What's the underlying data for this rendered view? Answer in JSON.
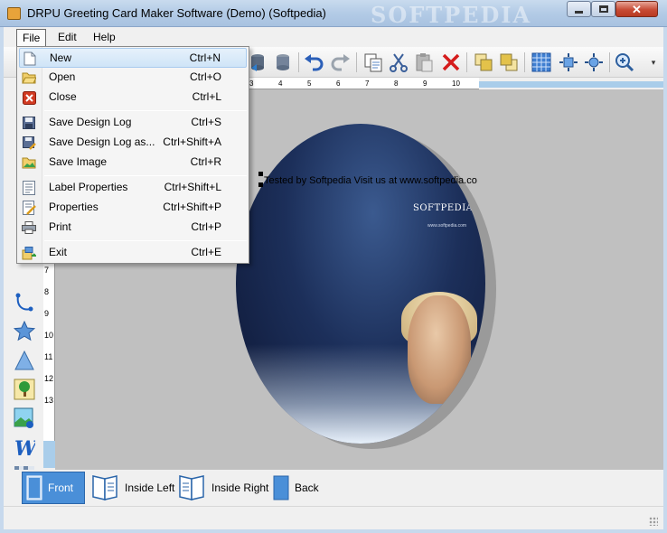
{
  "window": {
    "title": "DRPU Greeting Card Maker Software (Demo) (Softpedia)",
    "watermark": "SOFTPEDIA",
    "minimize_icon": "minimize-icon",
    "maximize_icon": "maximize-icon",
    "close_icon": "close-icon",
    "close_glyph": "✕"
  },
  "menubar": {
    "file": "File",
    "edit": "Edit",
    "help": "Help"
  },
  "file_menu": {
    "items": [
      {
        "label": "New",
        "shortcut": "Ctrl+N",
        "icon": "new-document-icon",
        "highlighted": true
      },
      {
        "label": "Open",
        "shortcut": "Ctrl+O",
        "icon": "open-folder-icon"
      },
      {
        "label": "Close",
        "shortcut": "Ctrl+L",
        "icon": "close-document-icon"
      },
      {
        "label": "Save Design Log",
        "shortcut": "Ctrl+S",
        "icon": "save-icon"
      },
      {
        "label": "Save Design Log as...",
        "shortcut": "Ctrl+Shift+A",
        "icon": "save-as-icon"
      },
      {
        "label": "Save Image",
        "shortcut": "Ctrl+R",
        "icon": "save-image-icon"
      },
      {
        "label": "Label Properties",
        "shortcut": "Ctrl+Shift+L",
        "icon": "label-properties-icon"
      },
      {
        "label": "Properties",
        "shortcut": "Ctrl+Shift+P",
        "icon": "properties-icon"
      },
      {
        "label": "Print",
        "shortcut": "Ctrl+P",
        "icon": "print-icon"
      },
      {
        "label": "Exit",
        "shortcut": "Ctrl+E",
        "icon": "exit-icon"
      }
    ]
  },
  "toolbar": {
    "icons": [
      "database-icon",
      "database-icon",
      "undo-icon",
      "redo-icon",
      "copy-icon",
      "cut-icon",
      "paste-icon",
      "delete-icon",
      "bring-front-icon",
      "send-back-icon",
      "grid-icon",
      "fit-page-icon",
      "fit-selection-icon",
      "zoom-in-icon"
    ],
    "overflow": "▾"
  },
  "ruler": {
    "horizontal_numbers": [
      "3",
      "4",
      "5",
      "6",
      "7",
      "8",
      "9",
      "10"
    ],
    "vertical_numbers": [
      "7",
      "8",
      "9",
      "10",
      "11",
      "12",
      "13"
    ]
  },
  "left_tools": [
    "curve-icon",
    "star-icon",
    "triangle-icon",
    "image-icon",
    "picture-icon",
    "wordart-icon",
    "pattern-icon"
  ],
  "canvas": {
    "caption": "Tested by Softpedia  Visit us at www.softpedia.co",
    "card_brand": "SOFTPEDIA",
    "card_brand_sub": "www.softpedia.com"
  },
  "pages": [
    {
      "label": "Front",
      "icon": "book-front-icon",
      "active": true
    },
    {
      "label": "Inside Left",
      "icon": "book-open-left-icon"
    },
    {
      "label": "Inside Right",
      "icon": "book-open-right-icon"
    },
    {
      "label": "Back",
      "icon": "book-back-icon"
    }
  ],
  "colors": {
    "accent": "#4a8fd8",
    "titlebar": "#b3cbe6",
    "menu_highlight": "#cfe4f7",
    "canvas": "#c0c0c0"
  }
}
